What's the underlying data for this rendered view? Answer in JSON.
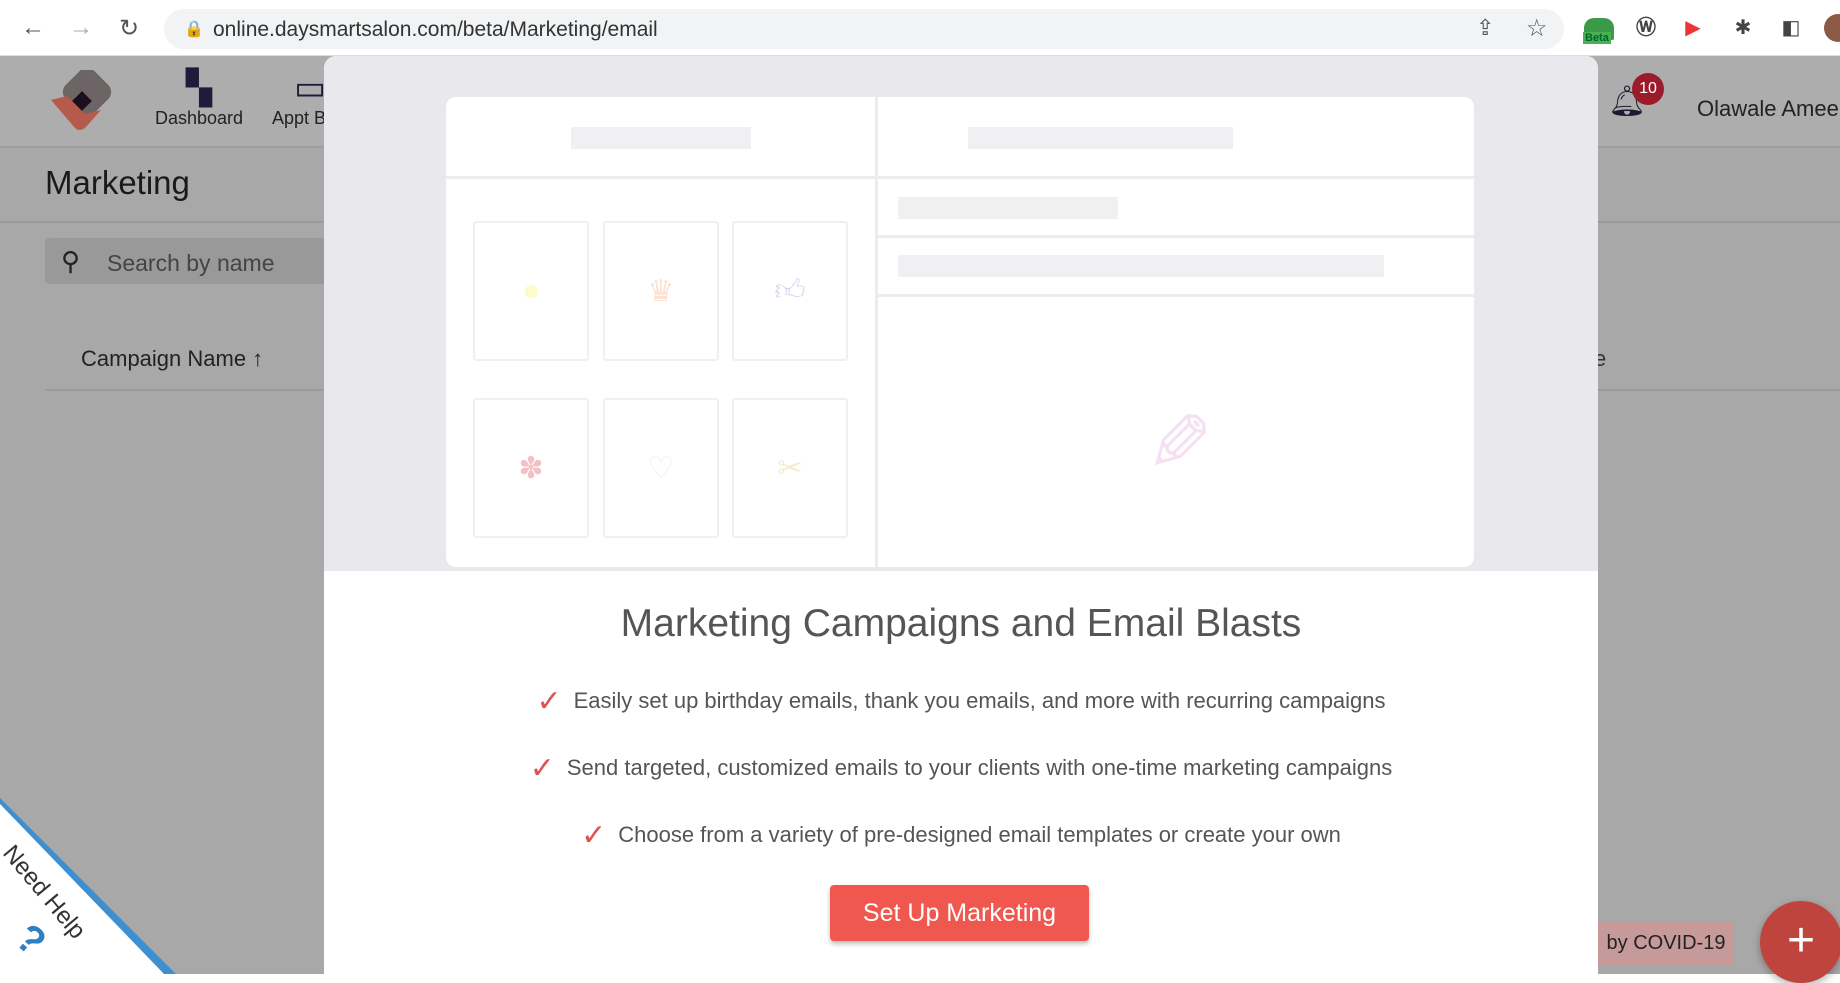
{
  "browser": {
    "url": "online.daysmartsalon.com/beta/Marketing/email",
    "extension_badge": "Beta"
  },
  "header": {
    "nav": [
      {
        "label": "Dashboard",
        "icon": "dashboard-icon"
      },
      {
        "label": "Appt B",
        "icon": "calendar-icon"
      }
    ],
    "notifications_count": "10",
    "user_name": "Olawale Ameer"
  },
  "page": {
    "title": "Marketing",
    "search_placeholder": "Search by name",
    "column_header": "Campaign Name ↑",
    "column_header_partial": "e"
  },
  "modal": {
    "template_icons": [
      "sun-icon",
      "cake-icon",
      "thumbs-up-icon",
      "yelp-icon",
      "heart-icon",
      "scissors-icon"
    ],
    "title": "Marketing Campaigns and Email Blasts",
    "bullets": [
      "Easily set up birthday emails, thank you emails, and more with recurring campaigns",
      "Send targeted, customized emails to your clients with one-time marketing campaigns",
      "Choose from a variety of pre-designed email templates or create your own"
    ],
    "cta_label": "Set Up Marketing"
  },
  "covid_tooltip": "by COVID-19",
  "need_help": "Need Help",
  "colors": {
    "accent": "#f0574e",
    "check": "#e0544f",
    "badge": "#9b1b2a"
  }
}
